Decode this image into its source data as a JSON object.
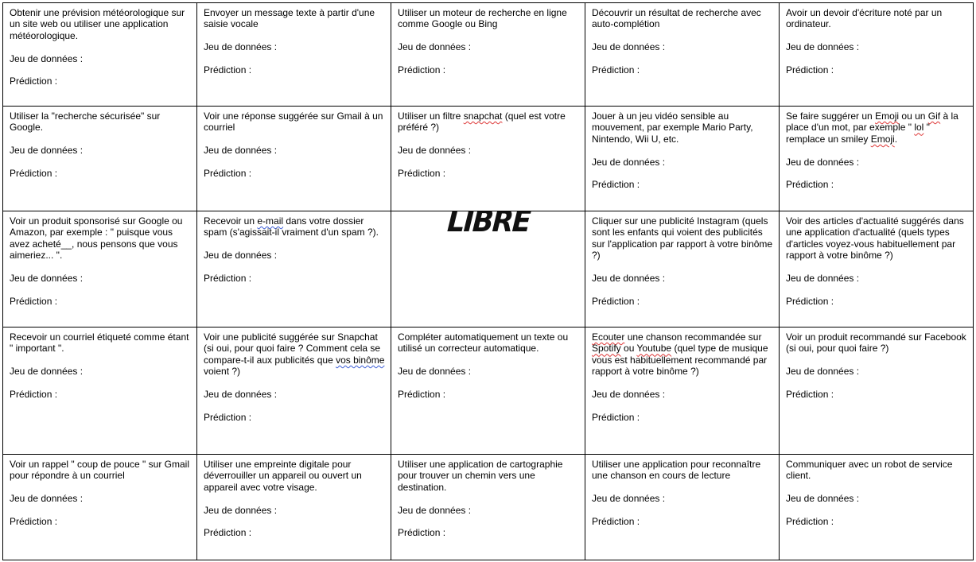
{
  "labels": {
    "dataset": "Jeu de données :",
    "prediction": "Prédiction :"
  },
  "free_square": "LIBRE",
  "cells": [
    {
      "parts": [
        [
          "Obtenir une prévision météorologique sur un site web ou utiliser une application météorologique.",
          ""
        ]
      ]
    },
    {
      "parts": [
        [
          "Envoyer un message texte à partir d'une saisie vocale",
          ""
        ]
      ]
    },
    {
      "parts": [
        [
          "Utiliser un moteur de recherche en ligne comme Google ou Bing",
          ""
        ]
      ]
    },
    {
      "parts": [
        [
          "Découvrir un résultat de recherche avec auto-complétion",
          ""
        ]
      ]
    },
    {
      "parts": [
        [
          "Avoir un devoir d'écriture noté par un ordinateur.",
          ""
        ]
      ]
    },
    {
      "parts": [
        [
          "Utiliser la \"recherche sécurisée\" sur Google.",
          ""
        ]
      ]
    },
    {
      "parts": [
        [
          "Voir une réponse suggérée sur Gmail à un courriel",
          ""
        ]
      ]
    },
    {
      "parts": [
        [
          "Utiliser un filtre ",
          ""
        ],
        [
          "snapchat",
          "sq"
        ],
        [
          " (quel est votre préféré ?)",
          ""
        ]
      ]
    },
    {
      "parts": [
        [
          "Jouer à un jeu vidéo sensible au mouvement, par exemple Mario Party, Nintendo, Wii U, etc.",
          ""
        ]
      ]
    },
    {
      "parts": [
        [
          "Se faire suggérer un ",
          ""
        ],
        [
          "Emoji",
          "sq"
        ],
        [
          " ou un ",
          ""
        ],
        [
          "Gif",
          "sq"
        ],
        [
          " à la place d'un mot, par exemple \" ",
          ""
        ],
        [
          "lol",
          "sq"
        ],
        [
          " \" remplace un smiley ",
          ""
        ],
        [
          "Emoji",
          "sq"
        ],
        [
          ".",
          ""
        ]
      ]
    },
    {
      "parts": [
        [
          "Voir un produit sponsorisé sur Google ou Amazon, par exemple : \" puisque vous avez acheté__, nous pensons que vous aimeriez... \".",
          ""
        ]
      ]
    },
    {
      "parts": [
        [
          "Recevoir un ",
          ""
        ],
        [
          "e-mail",
          "sqb"
        ],
        [
          " dans votre dossier spam (s'agissait-il vraiment d'un spam ?).",
          ""
        ]
      ]
    },
    {
      "free": true
    },
    {
      "parts": [
        [
          "Cliquer sur une publicité Instagram (quels sont les enfants qui voient des publicités sur l'application par rapport à votre binôme ?)",
          ""
        ]
      ]
    },
    {
      "parts": [
        [
          "Voir des articles d'actualité suggérés dans une application d'actualité (quels types d'articles voyez-vous habituellement par rapport à votre binôme ?)",
          ""
        ]
      ]
    },
    {
      "parts": [
        [
          "Recevoir un courriel étiqueté comme étant \" important \".",
          ""
        ]
      ]
    },
    {
      "parts": [
        [
          "Voir une publicité suggérée sur Snapchat (si oui, pour quoi faire ? Comment cela se compare-t-il aux publicités que ",
          ""
        ],
        [
          "vos binôme",
          "sqb"
        ],
        [
          " voient ?)",
          ""
        ]
      ]
    },
    {
      "parts": [
        [
          "Compléter automatiquement un texte ou utilisé un correcteur automatique.",
          ""
        ]
      ]
    },
    {
      "parts": [
        [
          "Ecouter",
          "sq"
        ],
        [
          " une chanson recommandée sur ",
          ""
        ],
        [
          "Spotify",
          "sq"
        ],
        [
          " ou ",
          ""
        ],
        [
          "Youtube",
          "sq"
        ],
        [
          " (quel type de musique vous est habituellement recommandé par rapport à votre binôme ?)",
          ""
        ]
      ]
    },
    {
      "parts": [
        [
          "Voir un produit recommandé sur Facebook (si oui, pour quoi faire ?)",
          ""
        ]
      ]
    },
    {
      "parts": [
        [
          "Voir un rappel \" coup de pouce \" sur Gmail pour répondre à un courriel",
          ""
        ]
      ]
    },
    {
      "parts": [
        [
          "Utiliser une empreinte digitale pour déverrouiller un appareil ou ouvert un appareil avec votre visage.",
          ""
        ]
      ]
    },
    {
      "parts": [
        [
          "Utiliser une application de cartographie pour trouver un chemin vers une destination.",
          ""
        ]
      ]
    },
    {
      "parts": [
        [
          "Utiliser une application pour reconnaître une chanson en cours de lecture",
          ""
        ]
      ]
    },
    {
      "parts": [
        [
          "Communiquer avec un robot de service client.",
          ""
        ]
      ]
    }
  ]
}
